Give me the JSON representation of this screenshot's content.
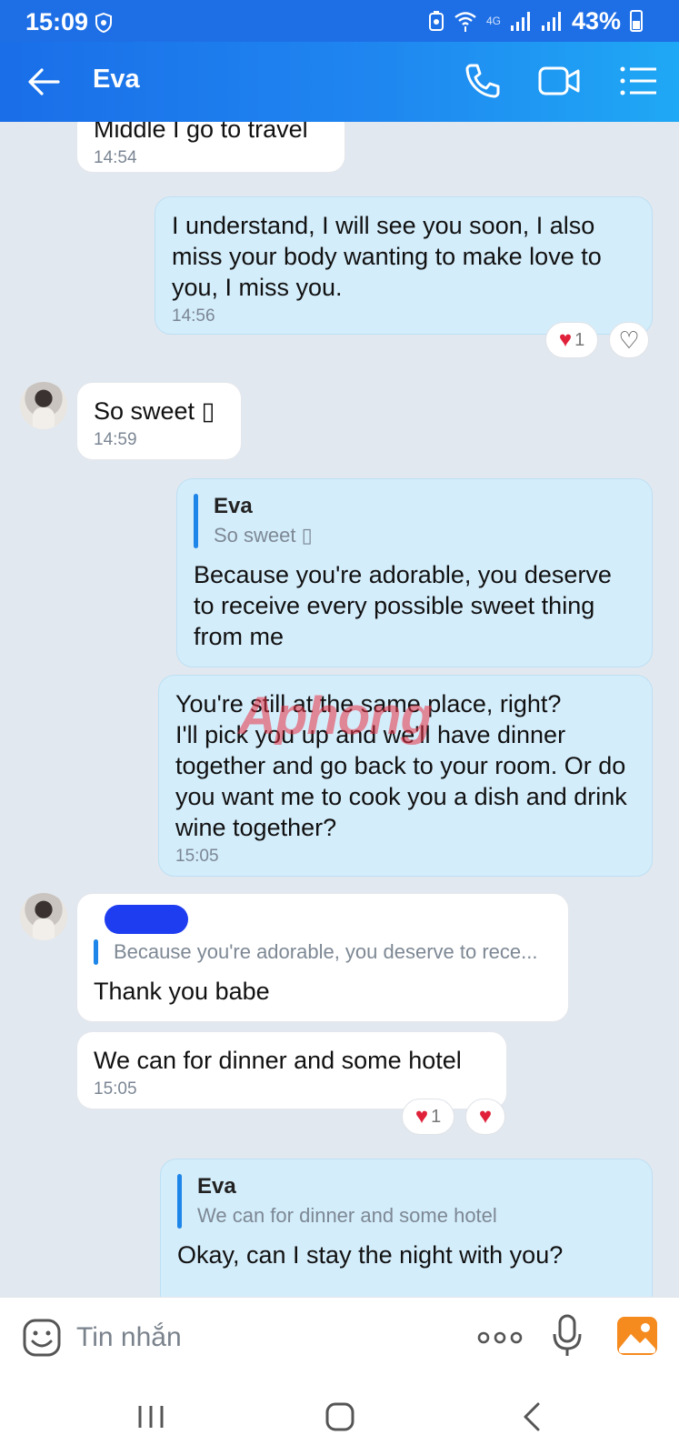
{
  "status_bar": {
    "time": "15:09",
    "network": "4G",
    "battery_percent": "43%"
  },
  "header": {
    "title": "Eva",
    "icons": [
      "back-arrow-icon",
      "phone-icon",
      "video-camera-icon",
      "list-menu-icon"
    ]
  },
  "messages": [
    {
      "direction": "incoming",
      "text": "Middle I go to travel",
      "time": "14:54"
    },
    {
      "direction": "outgoing",
      "text": "I understand, I will see you soon, I also miss your body wanting to make love to you, I miss you.",
      "time": "14:56",
      "reaction_count": "1"
    },
    {
      "direction": "incoming",
      "text": "So sweet ▯",
      "time": "14:59"
    },
    {
      "direction": "outgoing",
      "quote_name": "Eva",
      "quote_text": "So sweet ▯",
      "text": "Because you're adorable, you deserve to receive every possible sweet thing from me"
    },
    {
      "direction": "outgoing",
      "text": "You're still at the same place, right?\nI'll pick you up and we'll have dinner together and go back to your room. Or do you want me to cook you a dish and drink wine together?",
      "time": "15:05"
    },
    {
      "direction": "incoming",
      "quote_text": "Because you're adorable, you deserve to rece...",
      "text": "Thank you babe"
    },
    {
      "direction": "incoming",
      "text": "We can for dinner and some hotel",
      "time": "15:05",
      "reaction_count": "1"
    },
    {
      "direction": "outgoing",
      "quote_name": "Eva",
      "quote_text": "We can for dinner and some hotel",
      "text": "Okay, can I stay the night with you?"
    }
  ],
  "watermark": "Aphong",
  "input": {
    "placeholder": "Tin nhắn"
  },
  "colors": {
    "header": "#1e86f0",
    "chat_background": "#e2e8ef",
    "outgoing_bubble": "#d4edfb",
    "incoming_bubble": "#ffffff",
    "quote_bar": "#1e86e8",
    "heart": "#e0213a"
  }
}
